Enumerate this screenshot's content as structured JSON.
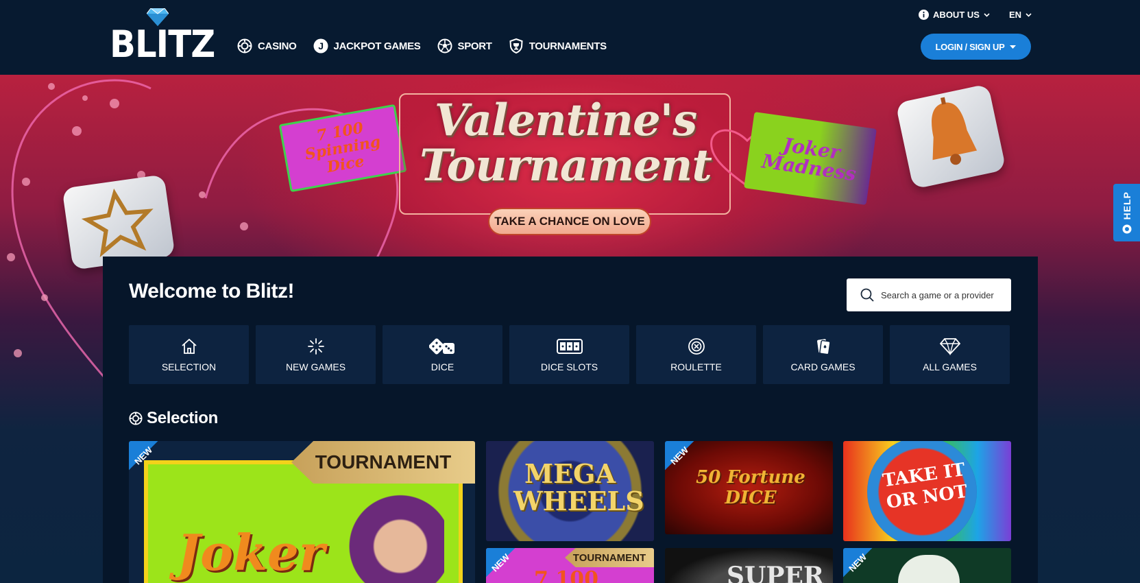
{
  "header": {
    "logo_text": "BLITZ",
    "nav": [
      {
        "label": "CASINO",
        "icon": "chip-icon"
      },
      {
        "label": "JACKPOT GAMES",
        "icon": "jackpot-icon"
      },
      {
        "label": "SPORT",
        "icon": "soccer-ball-icon"
      },
      {
        "label": "TOURNAMENTS",
        "icon": "shield-trophy-icon"
      }
    ],
    "about_label": "ABOUT US",
    "language_label": "EN",
    "login_label": "LOGIN / SIGN UP"
  },
  "banner": {
    "title": "Valentine's Tournament",
    "cta_label": "TAKE A CHANCE ON LOVE",
    "left_game": "7 100 Spinning Dice",
    "right_game": "Joker Madness"
  },
  "help_label": "HELP",
  "main": {
    "welcome": "Welcome to Blitz!",
    "search_placeholder": "Search a game or a provider",
    "categories": [
      {
        "label": "SELECTION",
        "icon": "home-icon"
      },
      {
        "label": "NEW GAMES",
        "icon": "sparkle-icon"
      },
      {
        "label": "DICE",
        "icon": "dice-icon"
      },
      {
        "label": "DICE SLOTS",
        "icon": "slot-machine-icon"
      },
      {
        "label": "ROULETTE",
        "icon": "roulette-icon"
      },
      {
        "label": "CARD GAMES",
        "icon": "cards-icon"
      },
      {
        "label": "ALL GAMES",
        "icon": "diamond-icon"
      }
    ],
    "section_title": "Selection",
    "tiles": [
      {
        "title": "Joker",
        "badge": "NEW",
        "ribbon": "TOURNAMENT"
      },
      {
        "title": "MEGA WHEELS"
      },
      {
        "title": "50 Fortune DICE",
        "badge": "NEW"
      },
      {
        "title": "TAKE IT OR NOT"
      },
      {
        "title": "7 100",
        "badge": "NEW",
        "ribbon": "TOURNAMENT"
      },
      {
        "title": "SUPER"
      },
      {
        "title": "",
        "badge": "NEW"
      }
    ]
  },
  "colors": {
    "header_bg": "#071a30",
    "accent_blue": "#1a7fd8",
    "panel_bg": "#06162a",
    "tile_bg": "#0d2340"
  }
}
